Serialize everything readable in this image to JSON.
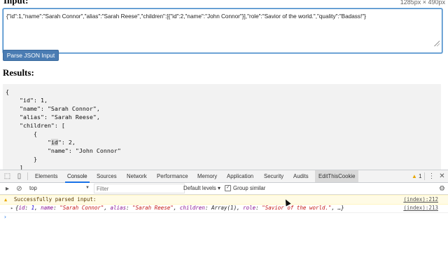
{
  "page": {
    "input_heading": "Input:",
    "dimensions": "1285px × 490px",
    "json_input_value": "{\"id\":1,\"name\":\"Sarah Connor\",\"alias\":\"Sarah Reese\",\"children\":[{\"id\":2,\"name\":\"John Connor\"}],\"role\":\"Savior of the world.\",\"quality\":\"Badass!\"}",
    "parse_button_label": "Parse JSON Input",
    "results_heading": "Results:",
    "result_lines": [
      "{",
      "    \"id\": 1,",
      "    \"name\": \"Sarah Connor\",",
      "    \"alias\": \"Sarah Reese\",",
      "    \"children\": [",
      "        {",
      "            \"id\": 2,",
      "            \"name\": \"John Connor\"",
      "        }",
      "    ]"
    ]
  },
  "devtools": {
    "tabs": [
      "Elements",
      "Console",
      "Sources",
      "Network",
      "Performance",
      "Memory",
      "Application",
      "Security",
      "Audits",
      "EditThisCookie"
    ],
    "active_tab": "Console",
    "warning_count": "1",
    "context": "top",
    "filter_placeholder": "Filter",
    "levels": "Default levels",
    "group_similar": "Group similar",
    "messages": [
      {
        "type": "warning",
        "text": "Successfully parsed input:",
        "source": "(index):212"
      },
      {
        "type": "log",
        "text": "{id: 1, name: \"Sarah Connor\", alias: \"Sarah Reese\", children: Array(1), role: \"Savior of the world.\", …}",
        "source": "(index):213"
      }
    ],
    "prompt": "›"
  },
  "icons": [
    "inspect-icon",
    "device-icon",
    "more-icon",
    "close-icon",
    "sidebar-icon",
    "clear-icon",
    "settings-icon",
    "warning-icon",
    "expand-arrow-icon"
  ],
  "colors": {
    "accent": "#1a73e8",
    "button": "#4a7cb3",
    "warning_bg": "#fffbe5"
  }
}
